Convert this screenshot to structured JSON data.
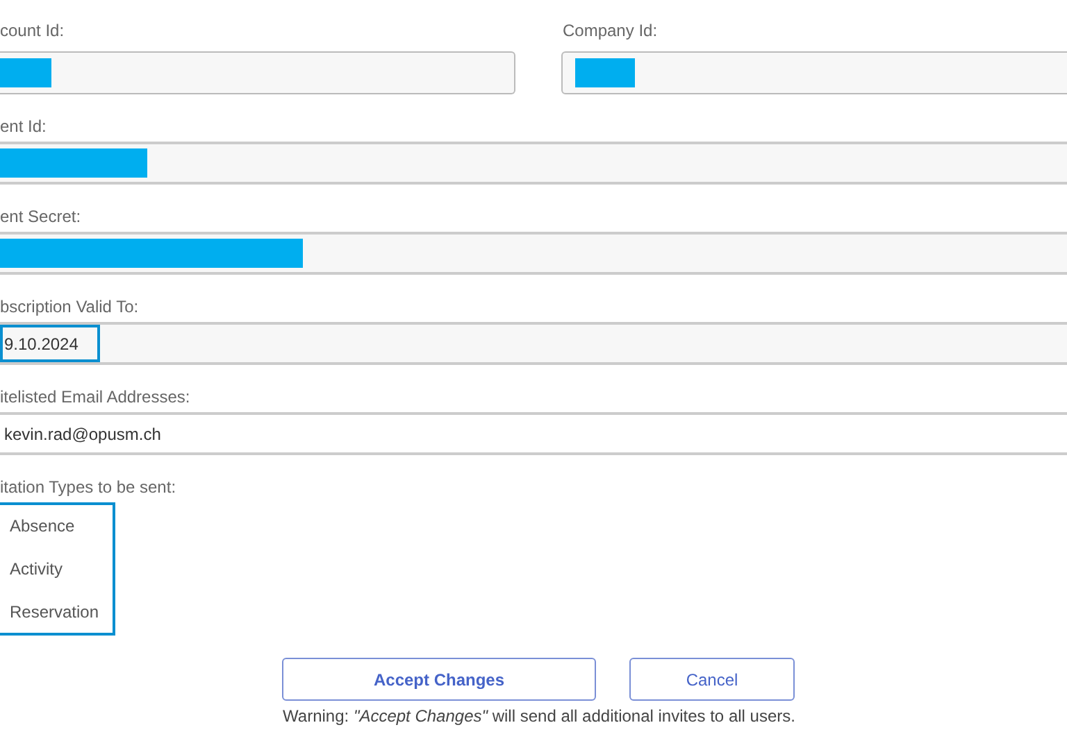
{
  "top_row": [
    {
      "label": "count Id:",
      "kind": "redacted"
    },
    {
      "label": "Company Id:",
      "kind": "redacted"
    }
  ],
  "fields": [
    {
      "label": "ent Id:",
      "kind": "redacted"
    },
    {
      "label": "ent Secret:",
      "kind": "redacted"
    },
    {
      "label": "bscription Valid To:",
      "kind": "text",
      "value": "9.10.2024",
      "focused": true
    },
    {
      "label": "itelisted Email Addresses:",
      "kind": "text",
      "value": "kevin.rad@opusm.ch"
    }
  ],
  "invitation_types": {
    "label": "itation Types to be sent:",
    "focused": true,
    "items": [
      "Absence",
      "Activity",
      "Reservation"
    ]
  },
  "buttons": [
    {
      "label": "Accept Changes",
      "kind": "primary"
    },
    {
      "label": "Cancel",
      "kind": "secondary"
    }
  ],
  "warning": "Warning: *\"Accept Changes\"* will send all additional invites to all users."
}
